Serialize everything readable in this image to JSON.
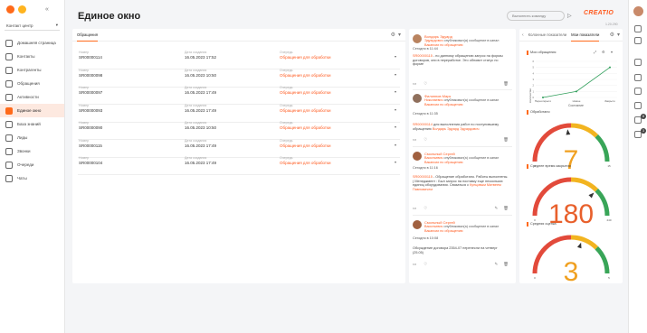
{
  "sidebar": {
    "contact_center": "Контакт центр",
    "items": [
      {
        "label": "Домашняя страница"
      },
      {
        "label": "Контакты"
      },
      {
        "label": "Контрагенты"
      },
      {
        "label": "Обращения"
      },
      {
        "label": "Активности"
      },
      {
        "label": "Единое окно"
      },
      {
        "label": "База знаний"
      },
      {
        "label": "Лиды"
      },
      {
        "label": "Звонки"
      },
      {
        "label": "Очереди"
      },
      {
        "label": "Чаты"
      }
    ]
  },
  "header": {
    "title": "Единое окно",
    "command_placeholder": "Выполнить команду",
    "brand": "CREATIO",
    "version": "1.20.290"
  },
  "requests": {
    "tab": "Обращения",
    "labels": {
      "number": "Номер",
      "created": "Дата создания",
      "queue": "Очередь"
    },
    "rows": [
      {
        "number": "SR00000114",
        "created": "16.05.2023 17:52",
        "status": "Обращения для обработки"
      },
      {
        "number": "SR00000098",
        "created": "16.05.2023 10:50",
        "status": "Обращения для обработки"
      },
      {
        "number": "SR00000097",
        "created": "16.05.2023 17:49",
        "status": "Обращения для обработки"
      },
      {
        "number": "SR00000093",
        "created": "16.05.2023 17:49",
        "status": "Обращения для обработки"
      },
      {
        "number": "SR00000090",
        "created": "16.05.2023 10:50",
        "status": "Обращения для обработки"
      },
      {
        "number": "SR00000115",
        "created": "16.05.2023 17:49",
        "status": "Обращения для обработки"
      },
      {
        "number": "SR00000104",
        "created": "16.05.2023 17:49",
        "status": "Обращения для обработки"
      }
    ]
  },
  "feed": {
    "posts": [
      {
        "author": "Волдарь Эдуард",
        "s1": "Эдуардович",
        "s2": "опубликовал(а) сообщение в канал",
        "channel": "Вакансии по обращению",
        "date": "Сегодня в 11:44",
        "b1": "SR00000115",
        "b2": "- по данному обращению запрос на формы договоров, они в переработке. Это обновит статус по форме"
      },
      {
        "author": "Филиппов Марк",
        "s1": "Николаевич",
        "s2": "опубликовал(а) сообщение в канал",
        "channel": "Вакансии по обращению",
        "date": "Сегодня в 11:35",
        "b1": "SR00000114",
        "b2": "для выполнения работ по поступившему обращению",
        "b3": "Волдарь Эдуард Эдуардович"
      },
      {
        "author": "Смольный Сергей",
        "s1": "Васильевич",
        "s2": "опубликовал(а) сообщение в канал",
        "channel": "Вакансии по обращению",
        "date": "Сегодня в 11:16",
        "b1": "SR00000115",
        "b2": "- Обращение обработано. Работы выполнены. ( Менеджмент : Был запрос на поставку еще нескольких единиц оборудования. Связаться с",
        "b3": "Купцовым Матвеем Павловичем"
      },
      {
        "author": "Смольный Сергей",
        "s1": "Васильевич",
        "s2": "опубликовал(а) сообщение в канал",
        "channel": "Вакансии по обращению",
        "date": "Сегодня в 10:08",
        "b2": "Обсуждение договора 2354-07 перенесли на четверг (25.05)"
      }
    ]
  },
  "dashboards": {
    "tabs": {
      "calls": "Колонные показатели",
      "mine": "Мои показатели"
    },
    "chart_title": "Мои обращения",
    "widgets": [
      "Обработано",
      "Среднее время закрытия",
      "Средняя оценка"
    ]
  },
  "chart_data": [
    {
      "type": "line",
      "title": "Мои обращения",
      "categories": [
        "Переоткрыто",
        "Новое",
        "Закрыто"
      ],
      "series": [
        {
          "values": [
            0,
            1,
            5
          ]
        }
      ],
      "xlabel": "Состояние",
      "ylabel": "Количество",
      "ylim": [
        0,
        6
      ]
    },
    {
      "type": "gauge",
      "title": "Обработано",
      "value": 7,
      "min": 0,
      "max": 15
    },
    {
      "type": "gauge",
      "title": "Среднее время закрытия",
      "value": 180,
      "min": 0,
      "max": 240
    },
    {
      "type": "gauge",
      "title": "Средняя оценка",
      "value": 3,
      "min": 0,
      "max": 5
    }
  ]
}
